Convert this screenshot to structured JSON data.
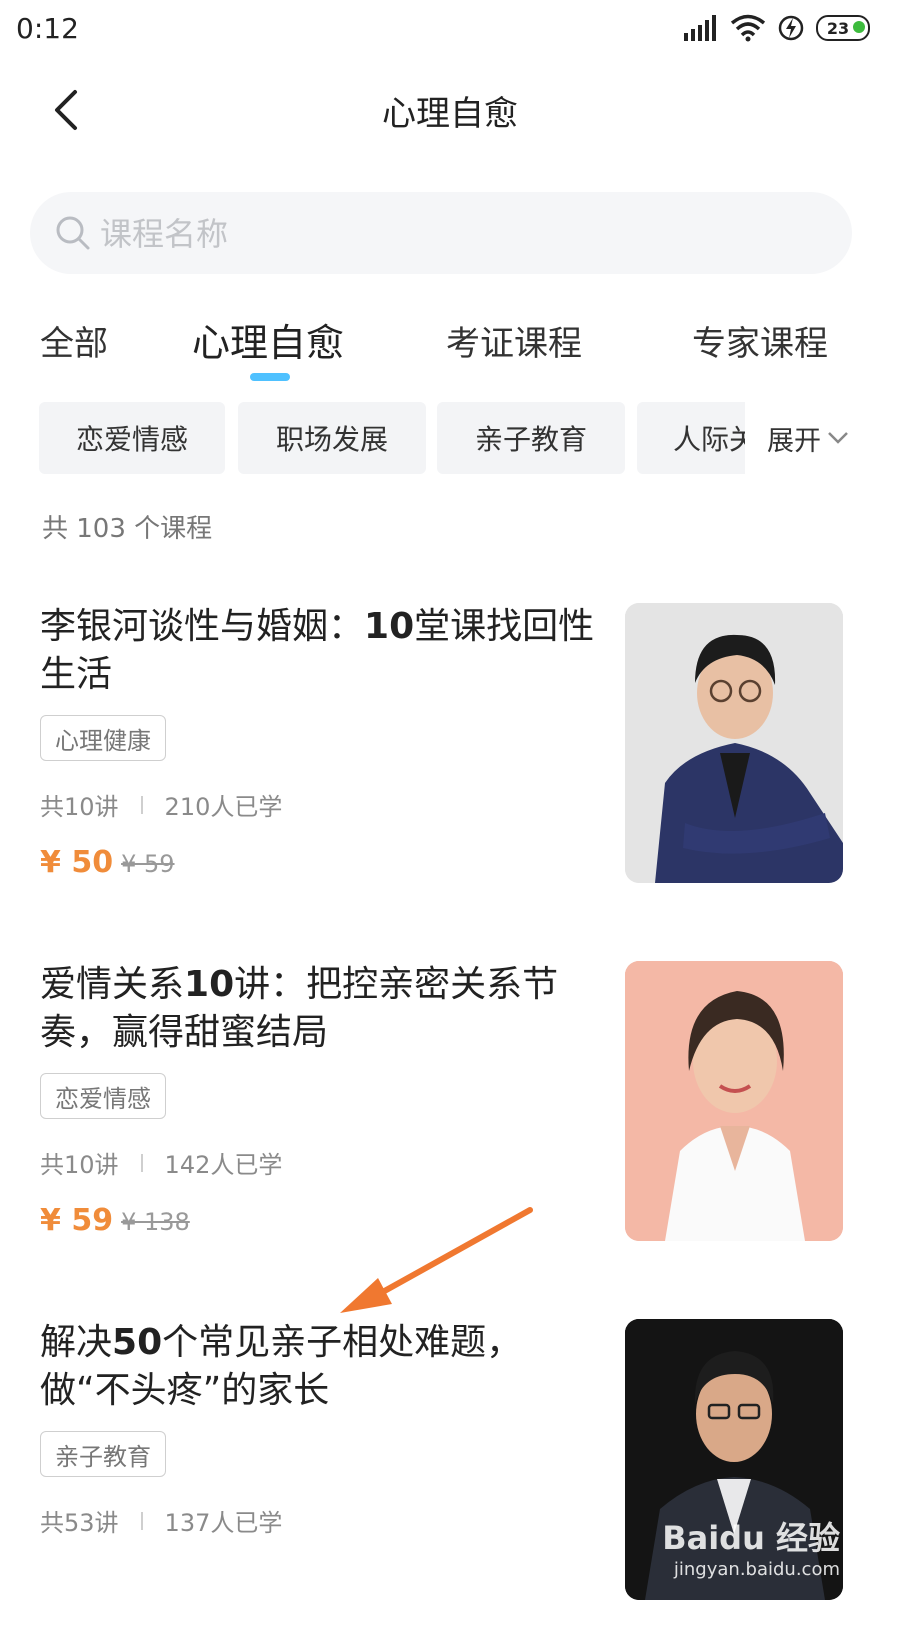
{
  "status_bar": {
    "time": "0:12",
    "battery": "23"
  },
  "header": {
    "title": "心理自愈"
  },
  "search": {
    "placeholder": "课程名称"
  },
  "tabs": [
    {
      "label": "全部"
    },
    {
      "label": "心理自愈"
    },
    {
      "label": "考证课程"
    },
    {
      "label": "专家课程"
    }
  ],
  "filters": {
    "chips": [
      {
        "label": "恋爱情感"
      },
      {
        "label": "职场发展"
      },
      {
        "label": "亲子教育"
      },
      {
        "label": "人际关"
      }
    ],
    "expand_label": "展开"
  },
  "course_count": "共 103 个课程",
  "courses": [
    {
      "title_a": "李银河谈性与婚姻：",
      "title_b": "10",
      "title_c": "堂课找回性生活",
      "tag": "心理健康",
      "lessons": "共10讲",
      "learners": "210人已学",
      "price": "¥ 50",
      "original_price": "¥ 59"
    },
    {
      "title_a": "爱情关系",
      "title_b": "10",
      "title_c": "讲：把控亲密关系节奏，赢得甜蜜结局",
      "tag": "恋爱情感",
      "lessons": "共10讲",
      "learners": "142人已学",
      "price": "¥ 59",
      "original_price": "¥ 138"
    },
    {
      "title_a": "解决",
      "title_b": "50",
      "title_c": "个常见亲子相处难题，做“不头疼”的家长",
      "tag": "亲子教育",
      "lessons": "共53讲",
      "learners": "137人已学"
    }
  ],
  "watermark": {
    "brand": "Baidu 经验",
    "url": "jingyan.baidu.com"
  },
  "colors": {
    "accent": "#4fc1ff",
    "price": "#f08c3a",
    "arrow": "#f07830"
  }
}
